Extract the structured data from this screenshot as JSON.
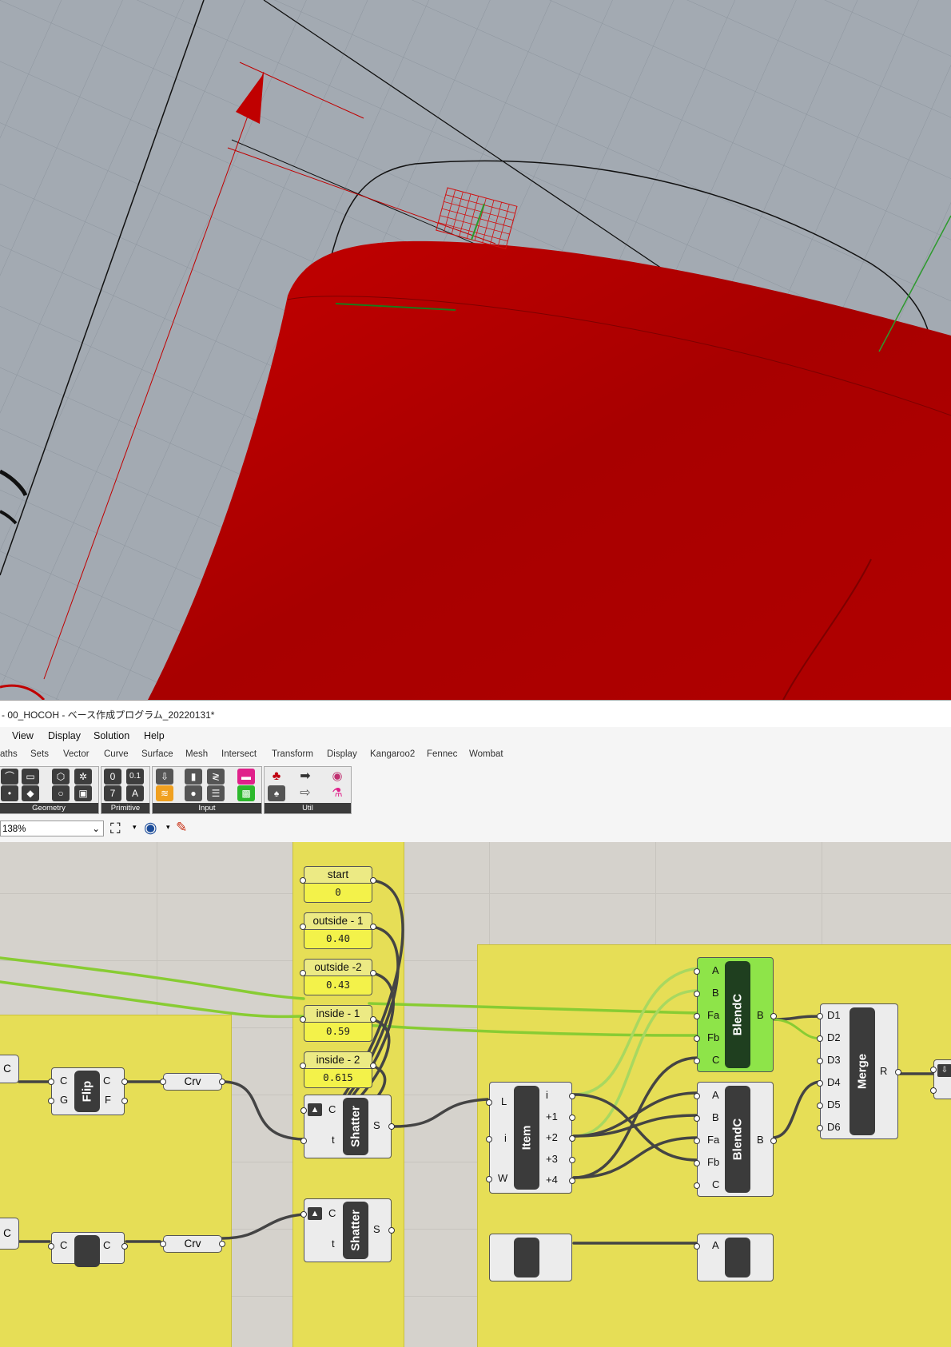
{
  "window": {
    "title": "- 00_HOCOH - ベース作成プログラム_20220131*"
  },
  "menu": [
    "View",
    "Display",
    "Solution",
    "Help"
  ],
  "tabs": [
    "aths",
    "Sets",
    "Vector",
    "Curve",
    "Surface",
    "Mesh",
    "Intersect",
    "Transform",
    "Display",
    "Kangaroo2",
    "Fennec",
    "Wombat"
  ],
  "ribbon": {
    "groups": [
      "Geometry",
      "Primitive",
      "Input",
      "Util"
    ],
    "icons": [
      "curve-icon",
      "surface-icon",
      "brep-icon",
      "mesh-icon",
      "point-icon",
      "vector-icon",
      "circle-icon",
      "box-icon",
      "boolean-icon",
      "number-icon",
      "integer-icon",
      "text-icon",
      "panel-icon",
      "slider-icon",
      "toggle-icon",
      "button-icon",
      "gradient-icon",
      "swatch-icon",
      "cherry-icon",
      "data-dam-icon",
      "relay-icon",
      "arrow-icon",
      "graft-icon",
      "flask-icon"
    ],
    "primitive_glyphs": [
      "0",
      "0.1",
      "7",
      "A"
    ]
  },
  "toolbar": {
    "zoom": "138%"
  },
  "sliders": [
    {
      "label": "start",
      "value": "0"
    },
    {
      "label": "outside - 1",
      "value": "0.40"
    },
    {
      "label": "outside -2",
      "value": "0.43"
    },
    {
      "label": "inside - 1",
      "value": "0.59"
    },
    {
      "label": "inside - 2",
      "value": "0.615"
    }
  ],
  "components": {
    "flip": {
      "name": "Flip",
      "inputs": [
        "C",
        "G"
      ],
      "outputs": [
        "C",
        "F"
      ]
    },
    "crv": {
      "name": "Crv"
    },
    "crv2": {
      "name": "Crv"
    },
    "shatter": {
      "name": "Shatter",
      "inputs": [
        "C",
        "t"
      ],
      "outputs": [
        "S"
      ]
    },
    "shatter2": {
      "name": "Shatter",
      "inputs": [
        "C",
        "t"
      ],
      "outputs": [
        "S"
      ]
    },
    "item": {
      "name": "Item",
      "inputs": [
        "L",
        "i",
        "W"
      ],
      "outputs": [
        "i",
        "+1",
        "+2",
        "+3",
        "+4"
      ]
    },
    "blend1": {
      "name": "BlendC",
      "inputs": [
        "A",
        "B",
        "Fa",
        "Fb",
        "C"
      ],
      "outputs": [
        "B"
      ]
    },
    "blend2": {
      "name": "BlendC",
      "inputs": [
        "A",
        "B",
        "Fa",
        "Fb",
        "C"
      ],
      "outputs": [
        "B"
      ]
    },
    "blend3": {
      "name": "A"
    },
    "merge": {
      "name": "Merge",
      "inputs": [
        "D1",
        "D2",
        "D3",
        "D4",
        "D5",
        "D6"
      ],
      "outputs": [
        "R"
      ]
    },
    "left_c": {
      "name": "C"
    },
    "left_c2": {
      "name": "C"
    },
    "flip2": {
      "inputs": [
        "C"
      ],
      "outputs": [
        "C"
      ]
    }
  },
  "colors": {
    "model_red": "#b00000",
    "wire_green": "#88cc33",
    "group_yellow": "#e6de56"
  }
}
